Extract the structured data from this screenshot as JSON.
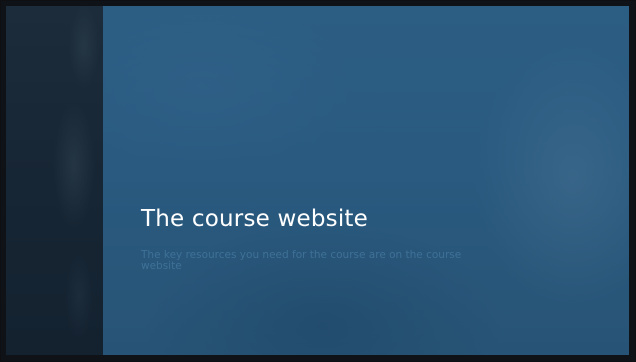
{
  "slide": {
    "title": "The course website",
    "subtitle": "The key resources you need for the course are on the course website"
  },
  "colors": {
    "background": "#2a5a80",
    "left_strip": "#172634",
    "title_text": "#ffffff",
    "subtitle_text": "#3f7197"
  }
}
